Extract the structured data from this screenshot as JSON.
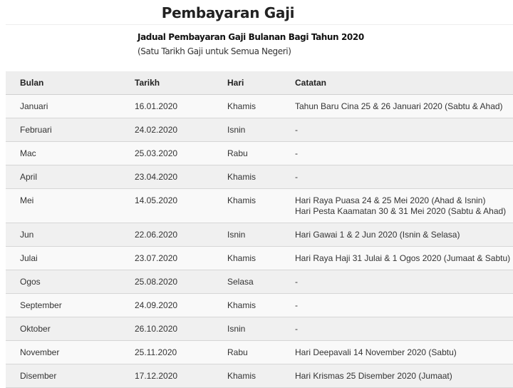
{
  "header": {
    "title": "Pembayaran Gaji",
    "subtitle": "Jadual Pembayaran Gaji Bulanan Bagi Tahun 2020",
    "note": "(Satu Tarikh Gaji untuk Semua Negeri)"
  },
  "table": {
    "columns": [
      "Bulan",
      "Tarikh",
      "Hari",
      "Catatan"
    ],
    "rows": [
      {
        "bulan": "Januari",
        "tarikh": "16.01.2020",
        "hari": "Khamis",
        "catatan": [
          "Tahun Baru Cina 25 & 26 Januari 2020 (Sabtu & Ahad)"
        ]
      },
      {
        "bulan": "Februari",
        "tarikh": "24.02.2020",
        "hari": "Isnin",
        "catatan": [
          "-"
        ]
      },
      {
        "bulan": "Mac",
        "tarikh": "25.03.2020",
        "hari": "Rabu",
        "catatan": [
          "-"
        ]
      },
      {
        "bulan": "April",
        "tarikh": "23.04.2020",
        "hari": "Khamis",
        "catatan": [
          "-"
        ]
      },
      {
        "bulan": "Mei",
        "tarikh": "14.05.2020",
        "hari": "Khamis",
        "catatan": [
          "Hari Raya Puasa 24 & 25 Mei 2020 (Ahad & Isnin)",
          "Hari Pesta Kaamatan 30 & 31 Mei 2020 (Sabtu & Ahad)"
        ]
      },
      {
        "bulan": "Jun",
        "tarikh": "22.06.2020",
        "hari": "Isnin",
        "catatan": [
          "Hari Gawai 1 & 2 Jun 2020 (Isnin & Selasa)"
        ]
      },
      {
        "bulan": "Julai",
        "tarikh": "23.07.2020",
        "hari": "Khamis",
        "catatan": [
          "Hari Raya Haji 31 Julai & 1 Ogos 2020 (Jumaat & Sabtu)"
        ]
      },
      {
        "bulan": "Ogos",
        "tarikh": "25.08.2020",
        "hari": "Selasa",
        "catatan": [
          "-"
        ]
      },
      {
        "bulan": "September",
        "tarikh": "24.09.2020",
        "hari": "Khamis",
        "catatan": [
          "-"
        ]
      },
      {
        "bulan": "Oktober",
        "tarikh": "26.10.2020",
        "hari": "Isnin",
        "catatan": [
          "-"
        ]
      },
      {
        "bulan": "November",
        "tarikh": "25.11.2020",
        "hari": "Rabu",
        "catatan": [
          "Hari Deepavali 14 November 2020 (Sabtu)"
        ]
      },
      {
        "bulan": "Disember",
        "tarikh": "17.12.2020",
        "hari": "Khamis",
        "catatan": [
          "Hari Krismas 25 Disember 2020 (Jumaat)"
        ]
      }
    ]
  }
}
